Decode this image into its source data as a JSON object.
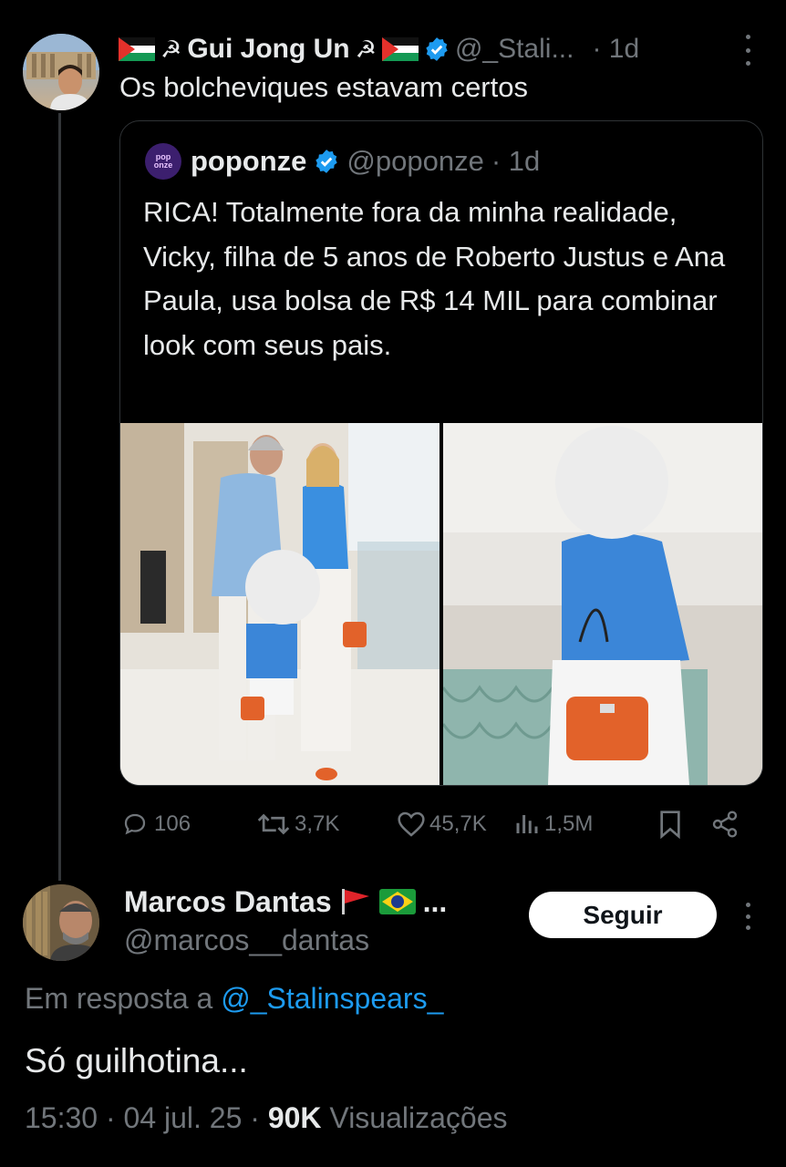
{
  "tweet": {
    "author_name": "Gui Jong Un",
    "author_symbol_left": "☭",
    "author_symbol_right": "☭",
    "handle": "@_Stali...",
    "time": "· 1d",
    "text": "Os bolcheviques estavam certos"
  },
  "quote": {
    "logo_text": "pop\nonze",
    "author_name": "poponze",
    "handle": "@poponze",
    "time": "· 1d",
    "text": "RICA! Totalmente fora da minha realidade, Vicky, filha de 5 anos de Roberto Justus e Ana Paula, usa bolsa de R$ 14 MIL para combinar look com seus pais."
  },
  "actions": {
    "replies": "106",
    "retweets": "3,7K",
    "likes": "45,7K",
    "views": "1,5M"
  },
  "reply": {
    "author_name": "Marcos Dantas",
    "name_suffix": "...",
    "handle": "@marcos__dantas",
    "follow_label": "Seguir",
    "in_reply_prefix": "Em resposta a",
    "in_reply_handle": "@_Stalinspears_",
    "text": "Só guilhotina...",
    "timestamp": "15:30 · 04 jul. 25 ·",
    "views_count": "90K",
    "views_label": "Visualizações"
  },
  "colors": {
    "background": "#000000",
    "text": "#e7e9ea",
    "muted": "#71767b",
    "link": "#1d9bf0",
    "verified": "#1d9bf0"
  }
}
